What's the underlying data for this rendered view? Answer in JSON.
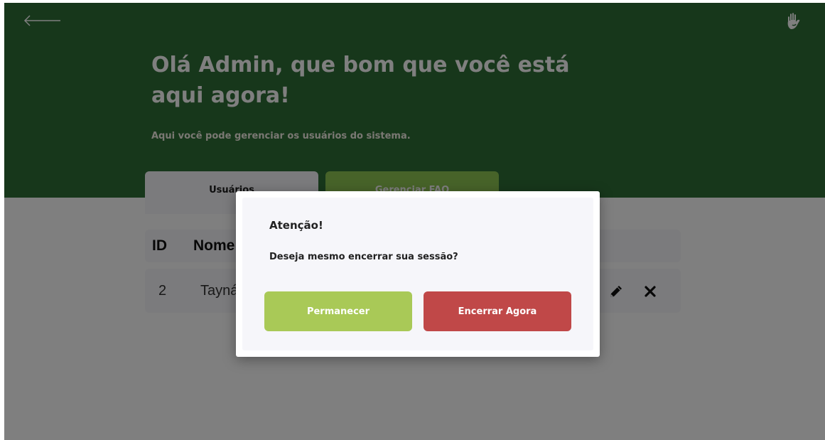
{
  "header": {
    "title": "Olá Admin, que bom que você está aqui agora!",
    "subtitle": "Aqui você pode gerenciar os usuários do sistema."
  },
  "tabs": [
    {
      "label": "Usuários"
    },
    {
      "label": "Gerenciar FAQ"
    }
  ],
  "table": {
    "columns": [
      "ID",
      "Nome"
    ],
    "rows": [
      {
        "id": "2",
        "name": "Tayná"
      }
    ]
  },
  "modal": {
    "title": "Atenção!",
    "message": "Deseja mesmo encerrar sua sessão?",
    "stay_label": "Permanecer",
    "logout_label": "Encerrar Agora"
  },
  "icons": {
    "back": "arrow-left-icon",
    "logo": "hand-icon",
    "edit": "pencil-icon",
    "delete": "close-icon"
  },
  "colors": {
    "header_green": "#2f6e37",
    "faq_tab_green": "#8fc653",
    "stay_button": "#a9c957",
    "logout_button": "#c04848",
    "card_background": "#f6f6fa"
  }
}
